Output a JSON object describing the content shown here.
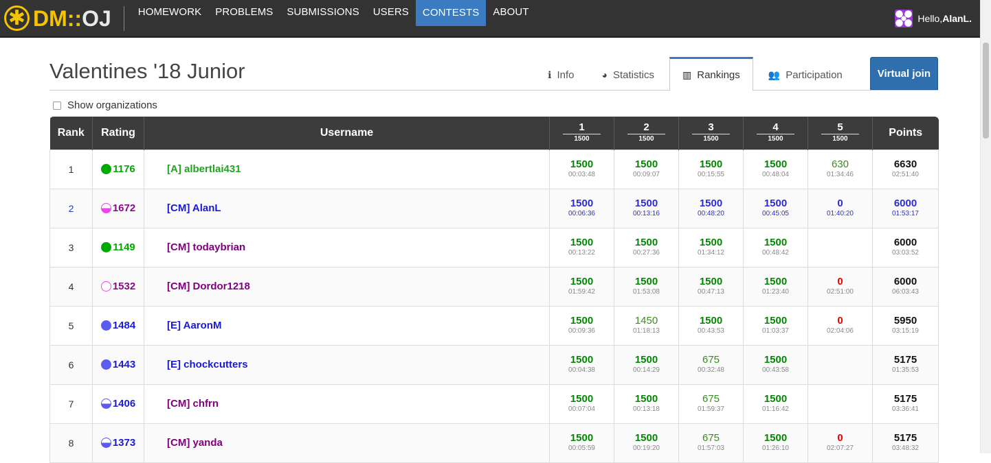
{
  "nav": {
    "brand": {
      "dm": "DM",
      "colons": "::",
      "oj": "OJ"
    },
    "items": [
      "HOMEWORK",
      "PROBLEMS",
      "SUBMISSIONS",
      "USERS",
      "CONTESTS",
      "ABOUT"
    ],
    "active": "CONTESTS",
    "greeting": "Hello, ",
    "username": "AlanL."
  },
  "contest": {
    "title": "Valentines '18 Junior",
    "tabs": [
      {
        "label": "Info",
        "icon": "info-icon",
        "glyph": "ℹ"
      },
      {
        "label": "Statistics",
        "icon": "pie-chart-icon",
        "glyph": "◕"
      },
      {
        "label": "Rankings",
        "icon": "bar-chart-icon",
        "glyph": "▥"
      },
      {
        "label": "Participation",
        "icon": "users-icon",
        "glyph": "👥"
      }
    ],
    "active_tab": "Rankings",
    "virtual_join": "Virtual join"
  },
  "show_orgs_label": "Show organizations",
  "table": {
    "headers": {
      "rank": "Rank",
      "rating": "Rating",
      "username": "Username",
      "points": "Points"
    },
    "problems": [
      {
        "num": "1",
        "value": "1500"
      },
      {
        "num": "2",
        "value": "1500"
      },
      {
        "num": "3",
        "value": "1500"
      },
      {
        "num": "4",
        "value": "1500"
      },
      {
        "num": "5",
        "value": "1500"
      }
    ],
    "colors": {
      "full": "#008800",
      "partial": "#3a8a20",
      "zero": "#ee0000",
      "self": "#2b2bd6"
    },
    "rows": [
      {
        "rank": "1",
        "rating": "1176",
        "rating_color": "#00a900",
        "circle": "full",
        "user": "[A] albertlai431",
        "user_color": "#24a224",
        "self": false,
        "problems": [
          {
            "s": "1500",
            "t": "00:03:48",
            "k": "full"
          },
          {
            "s": "1500",
            "t": "00:09:07",
            "k": "full"
          },
          {
            "s": "1500",
            "t": "00:15:55",
            "k": "full"
          },
          {
            "s": "1500",
            "t": "00:48:04",
            "k": "full"
          },
          {
            "s": "630",
            "t": "01:34:46",
            "k": "partial"
          }
        ],
        "points": "6630",
        "ptime": "02:51:40"
      },
      {
        "rank": "2",
        "rating": "1672",
        "rating_color": "#8b0a8b",
        "circle": "half-pink",
        "user": "[CM] AlanL",
        "user_color": "#1a1ad6",
        "self": true,
        "problems": [
          {
            "s": "1500",
            "t": "00:06:36",
            "k": "self"
          },
          {
            "s": "1500",
            "t": "00:13:16",
            "k": "self"
          },
          {
            "s": "1500",
            "t": "00:48:20",
            "k": "self"
          },
          {
            "s": "1500",
            "t": "00:45:05",
            "k": "self"
          },
          {
            "s": "0",
            "t": "01:40:20",
            "k": "self"
          }
        ],
        "points": "6000",
        "ptime": "01:53:17"
      },
      {
        "rank": "3",
        "rating": "1149",
        "rating_color": "#00a900",
        "circle": "full",
        "user": "[CM] todaybrian",
        "user_color": "#800080",
        "self": false,
        "problems": [
          {
            "s": "1500",
            "t": "00:13:22",
            "k": "full"
          },
          {
            "s": "1500",
            "t": "00:27:36",
            "k": "full"
          },
          {
            "s": "1500",
            "t": "01:34:12",
            "k": "full"
          },
          {
            "s": "1500",
            "t": "00:48:42",
            "k": "full"
          },
          {
            "s": "",
            "t": "",
            "k": "empty"
          }
        ],
        "points": "6000",
        "ptime": "03:03:52"
      },
      {
        "rank": "4",
        "rating": "1532",
        "rating_color": "#8b0a8b",
        "circle": "ring-pink",
        "user": "[CM] Dordor1218",
        "user_color": "#800080",
        "self": false,
        "problems": [
          {
            "s": "1500",
            "t": "01:59:42",
            "k": "full"
          },
          {
            "s": "1500",
            "t": "01:53:08",
            "k": "full"
          },
          {
            "s": "1500",
            "t": "00:47:13",
            "k": "full"
          },
          {
            "s": "1500",
            "t": "01:23:40",
            "k": "full"
          },
          {
            "s": "0",
            "t": "02:51:00",
            "k": "zero"
          }
        ],
        "points": "6000",
        "ptime": "06:03:43"
      },
      {
        "rank": "5",
        "rating": "1484",
        "rating_color": "#1a1ad6",
        "circle": "full-blue",
        "user": "[E] AaronM",
        "user_color": "#1a1ad6",
        "self": false,
        "problems": [
          {
            "s": "1500",
            "t": "00:09:36",
            "k": "full"
          },
          {
            "s": "1450",
            "t": "01:18:13",
            "k": "partial"
          },
          {
            "s": "1500",
            "t": "00:43:53",
            "k": "full"
          },
          {
            "s": "1500",
            "t": "01:03:37",
            "k": "full"
          },
          {
            "s": "0",
            "t": "02:04:06",
            "k": "zero"
          }
        ],
        "points": "5950",
        "ptime": "03:15:19"
      },
      {
        "rank": "6",
        "rating": "1443",
        "rating_color": "#1a1ad6",
        "circle": "full-blue",
        "user": "[E] chockcutters",
        "user_color": "#1a1ad6",
        "self": false,
        "problems": [
          {
            "s": "1500",
            "t": "00:04:38",
            "k": "full"
          },
          {
            "s": "1500",
            "t": "00:14:29",
            "k": "full"
          },
          {
            "s": "675",
            "t": "00:32:48",
            "k": "partial"
          },
          {
            "s": "1500",
            "t": "00:43:58",
            "k": "full"
          },
          {
            "s": "",
            "t": "",
            "k": "empty"
          }
        ],
        "points": "5175",
        "ptime": "01:35:53"
      },
      {
        "rank": "7",
        "rating": "1406",
        "rating_color": "#1a1ad6",
        "circle": "half-blue",
        "user": "[CM] chfrn",
        "user_color": "#800080",
        "self": false,
        "problems": [
          {
            "s": "1500",
            "t": "00:07:04",
            "k": "full"
          },
          {
            "s": "1500",
            "t": "00:13:18",
            "k": "full"
          },
          {
            "s": "675",
            "t": "01:59:37",
            "k": "partial"
          },
          {
            "s": "1500",
            "t": "01:16:42",
            "k": "full"
          },
          {
            "s": "",
            "t": "",
            "k": "empty"
          }
        ],
        "points": "5175",
        "ptime": "03:36:41"
      },
      {
        "rank": "8",
        "rating": "1373",
        "rating_color": "#1a1ad6",
        "circle": "half-blue",
        "user": "[CM] yanda",
        "user_color": "#800080",
        "self": false,
        "problems": [
          {
            "s": "1500",
            "t": "00:05:59",
            "k": "full"
          },
          {
            "s": "1500",
            "t": "00:19:20",
            "k": "full"
          },
          {
            "s": "675",
            "t": "01:57:03",
            "k": "partial"
          },
          {
            "s": "1500",
            "t": "01:26:10",
            "k": "full"
          },
          {
            "s": "0",
            "t": "02:07:27",
            "k": "zero"
          }
        ],
        "points": "5175",
        "ptime": "03:48:32"
      }
    ]
  }
}
